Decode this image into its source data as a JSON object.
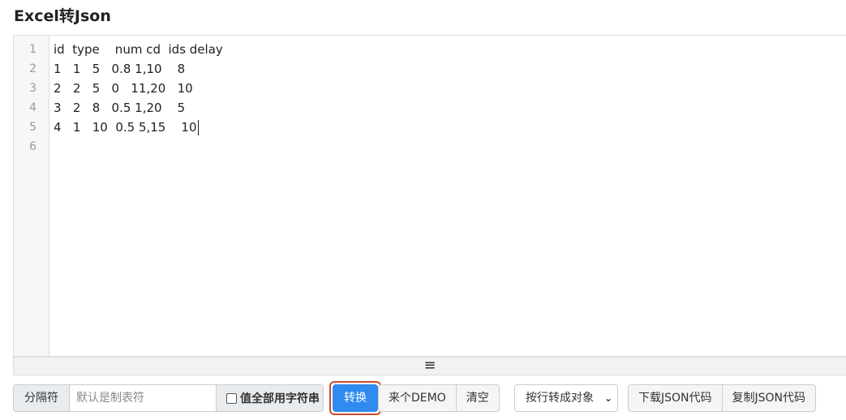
{
  "title": "Excel转Json",
  "editor": {
    "line_numbers": [
      "1",
      "2",
      "3",
      "4",
      "5",
      "6"
    ],
    "lines": [
      "id  type    num cd  ids delay",
      "1   1   5   0.8 1,10    8",
      "2   2   5   0   11,20   10",
      "3   2   8   0.5 1,20    5",
      "4   1   10  0.5 5,15    10",
      ""
    ]
  },
  "resizer": {
    "glyph": "≡"
  },
  "toolbar": {
    "separator_label": "分隔符",
    "separator_placeholder": "默认是制表符",
    "all_string_label": "值全部用字符串",
    "all_string_checked": false,
    "convert_label": "转换",
    "demo_label": "来个DEMO",
    "clear_label": "清空",
    "mode_selected": "按行转成对象",
    "download_label": "下载JSON代码",
    "copy_label": "复制JSON代码"
  },
  "colors": {
    "primary": "#2f8bf0",
    "highlight_outline": "#d04a2a"
  }
}
